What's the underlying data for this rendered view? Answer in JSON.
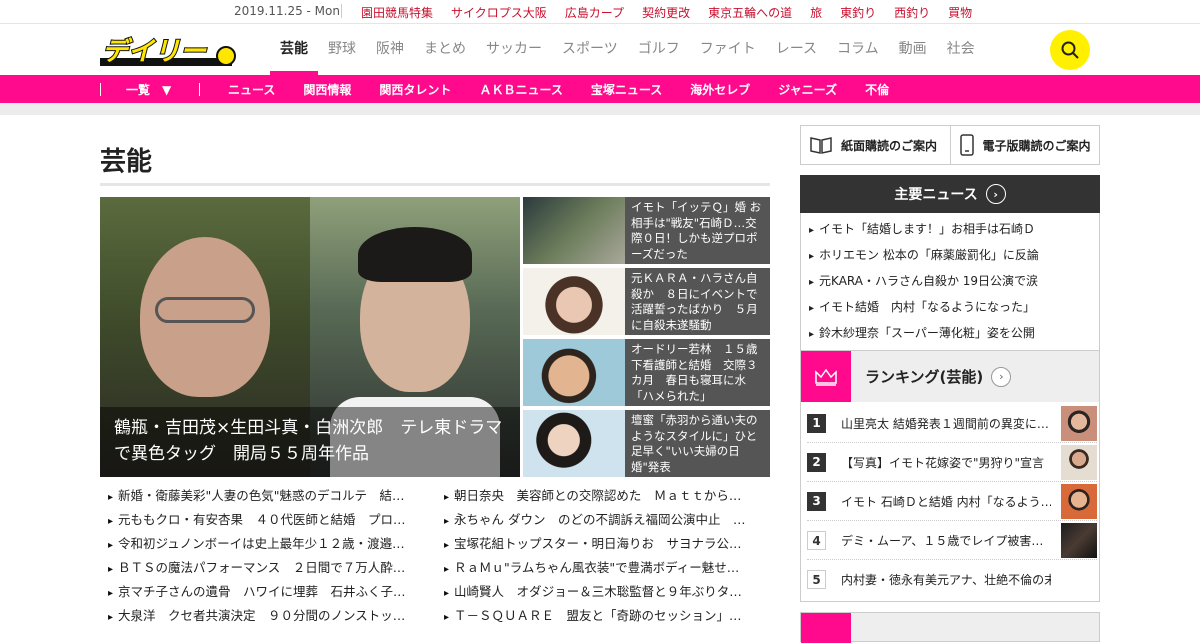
{
  "topbar": {
    "date": "2019.11.25 - Mon",
    "links": [
      "園田競馬特集",
      "サイクロプス大阪",
      "広島カープ",
      "契約更改",
      "東京五輪への道",
      "旅",
      "東釣り",
      "西釣り",
      "買物"
    ]
  },
  "header": {
    "logo_text": "デイリー",
    "nav": [
      "芸能",
      "野球",
      "阪神",
      "まとめ",
      "サッカー",
      "スポーツ",
      "ゴルフ",
      "ファイト",
      "レース",
      "コラム",
      "動画",
      "社会"
    ],
    "active_nav": "芸能",
    "search_icon": "search-icon"
  },
  "subnav": {
    "list_all": "一覧",
    "items": [
      "ニュース",
      "関西情報",
      "関西タレント",
      "ＡＫＢニュース",
      "宝塚ニュース",
      "海外セレブ",
      "ジャニーズ",
      "不倫"
    ]
  },
  "main": {
    "page_title": "芸能",
    "hero": {
      "caption": "鶴瓶・吉田茂×生田斗真・白洲次郎　テレ東ドラマで異色タッグ　開局５５周年作品"
    },
    "side_news": [
      {
        "text": "イモト「イッテＱ」婚 お相手は\"戦友\"石崎Ｄ…交際０日！しかも逆プロポーズだった"
      },
      {
        "text": "元ＫＡＲＡ・ハラさん自殺か　８日にイベントで活躍誓ったばかり　５月に自殺未遂騒動"
      },
      {
        "text": "オードリー若林　１５歳下看護師と結婚　交際３カ月　春日も寝耳に水「ハメられた」"
      },
      {
        "text": "壇蜜「赤羽から通い夫のようなスタイルに」ひと足早く\"いい夫婦の日婚\"発表"
      }
    ],
    "list_left": [
      "新婚・衛藤美彩\"人妻の色気\"魅惑のデコルテ　結…",
      "元ももクロ・有安杏果　４０代医師と結婚　プロ…",
      "令和初ジュノンボーイは史上最年少１２歳・渡邉…",
      "ＢＴＳの魔法パフォーマンス　２日間で７万人酔…",
      "京マチ子さんの遺骨　ハワイに埋葬　石井ふく子…",
      "大泉洋　クセ者共演決定　９０分間のノンストッ…"
    ],
    "list_right": [
      "朝日奈央　美容師との交際認めた　Ｍａｔｔから…",
      "永ちゃん ダウン　のどの不調訴え福岡公演中止　…",
      "宝塚花組トップスター・明日海りお　サヨナラ公…",
      "ＲａＭｕ\"ラムちゃん風衣装\"で豊満ボディー魅せ…",
      "山崎賢人　オダジョー＆三木聡監督と９年ぶりタ…",
      "Ｔ－ＳＱＵＡＲＥ　盟友と「奇跡のセッション」…"
    ]
  },
  "sidebar": {
    "subscribe_paper": "紙面購読のご案内",
    "subscribe_digital": "電子版購読のご案内",
    "main_news_title": "主要ニュース",
    "main_news": [
      "イモト「結婚します！」お相手は石崎Ｄ",
      "ホリエモン 松本の「麻薬厳罰化」に反論",
      "元KARA・ハラさん自殺か 19日公演で涙",
      "イモト結婚　内村「なるようになった」",
      "鈴木紗理奈「スーパー薄化粧」姿を公開"
    ],
    "ranking_title": "ランキング(芸能)",
    "ranking": [
      {
        "rank": "1",
        "text": "山里亮太 結婚発表１週間前の異変に…"
      },
      {
        "rank": "2",
        "text": "【写真】イモト花嫁姿で\"男狩り\"宣言"
      },
      {
        "rank": "3",
        "text": "イモト 石崎Ｄと結婚 内村「なるよう…"
      },
      {
        "rank": "4",
        "text": "デミ・ムーア、１５歳でレイプ被害…"
      },
      {
        "rank": "5",
        "text": "内村妻・徳永有美元アナ、壮絶不倫の末離…"
      }
    ]
  },
  "colors": {
    "brand_pink": "#ff0a8c",
    "search_yellow": "#fff000",
    "dark": "#333333",
    "link_red": "#c8102e"
  }
}
